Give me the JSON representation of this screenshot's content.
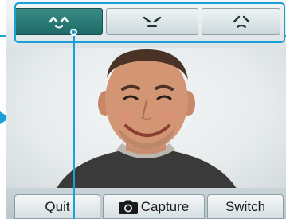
{
  "tabs": [
    {
      "icon": "happy-eyes-icon",
      "active": true
    },
    {
      "icon": "angry-eyes-icon",
      "active": false
    },
    {
      "icon": "sad-eyes-icon",
      "active": false
    }
  ],
  "photo": {
    "description_icon": "face-photo-icon"
  },
  "buttons": {
    "quit_label": "Quit",
    "capture_label": "Capture",
    "switch_label": "Switch"
  },
  "colors": {
    "accent": "#1a9fd6",
    "active_tab": "#2a7c78",
    "button_bg": "#e8eef0"
  }
}
